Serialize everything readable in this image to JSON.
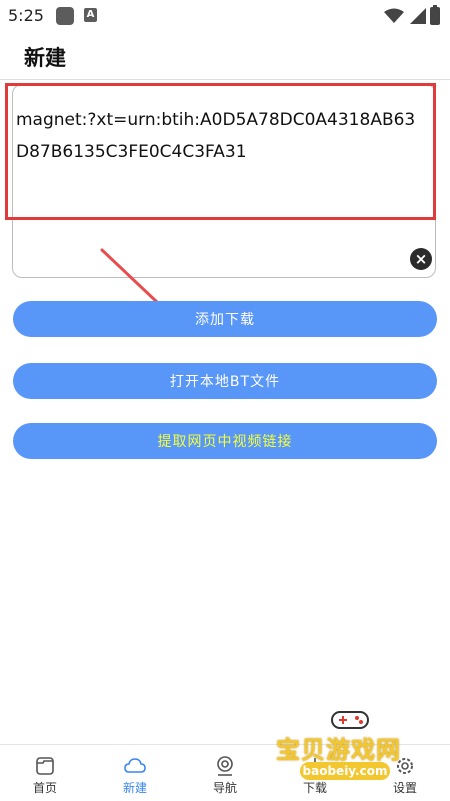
{
  "status_bar": {
    "time": "5:25",
    "notif_icon_2_glyph": "A"
  },
  "header": {
    "title": "新建"
  },
  "input": {
    "value": "magnet:?xt=urn:btih:A0D5A78DC0A4318AB63D87B6135C3FE0C4C3FA31",
    "clear_symbol": "×"
  },
  "actions": {
    "add_download": "添加下载",
    "open_local_bt": "打开本地BT文件",
    "extract_video_link": "提取网页中视频链接"
  },
  "bottom_nav": {
    "items": [
      {
        "label": "首页",
        "icon": "home-icon",
        "active": false
      },
      {
        "label": "新建",
        "icon": "cloud-icon",
        "active": true
      },
      {
        "label": "导航",
        "icon": "navigation-icon",
        "active": false
      },
      {
        "label": "下载",
        "icon": "download-icon",
        "active": false
      },
      {
        "label": "设置",
        "icon": "gear-icon",
        "active": false
      }
    ]
  },
  "watermark": {
    "text": "宝贝游戏网",
    "url": "baobeiy.com"
  },
  "colors": {
    "accent": "#5896f8",
    "active_tab": "#3a86f0",
    "highlight": "#e03a3a",
    "extract_text": "#f5ff3a"
  }
}
